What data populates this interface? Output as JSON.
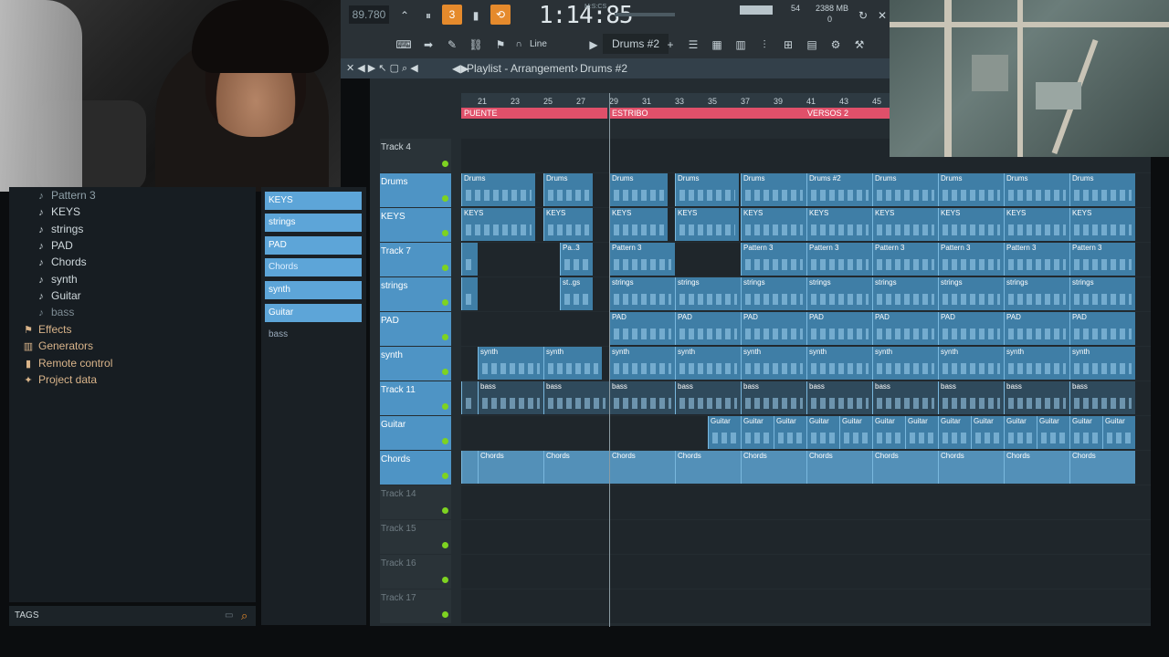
{
  "toolbar": {
    "tempo": "89.780",
    "time": "1:14:85",
    "time_label": "M:S:CS",
    "cpu": "54",
    "memory": "2388 MB",
    "poly": "0",
    "snap": "Line",
    "pattern": "Drums #2"
  },
  "playlist": {
    "breadcrumb": "Playlist - Arrangement",
    "pattern": "Drums #2",
    "ruler": [
      "21",
      "23",
      "25",
      "27",
      "29",
      "31",
      "33",
      "35",
      "37",
      "39",
      "41",
      "43",
      "45"
    ],
    "markers": [
      "PUENTE",
      "ESTRIBO",
      "VERSOS 2"
    ],
    "tracks": [
      {
        "name": "Track 4"
      },
      {
        "name": "Drums"
      },
      {
        "name": "KEYS"
      },
      {
        "name": "Track 7"
      },
      {
        "name": "strings"
      },
      {
        "name": "PAD"
      },
      {
        "name": "synth"
      },
      {
        "name": "Track 11"
      },
      {
        "name": "Guitar"
      },
      {
        "name": "Chords"
      },
      {
        "name": "Track 14"
      },
      {
        "name": "Track 15"
      },
      {
        "name": "Track 16"
      },
      {
        "name": "Track 17"
      }
    ],
    "clips": {
      "drums": "Drums",
      "drums2": "Drums #2",
      "keys": "KEYS",
      "pattern3": "Pattern 3",
      "pa3": "Pa..3",
      "strings": "strings",
      "st_gs": "st..gs",
      "pad": "PAD",
      "synth": "synth",
      "bass": "bass",
      "guitar": "Guitar",
      "chords": "Chords"
    }
  },
  "browser": {
    "items": [
      "Pattern 3",
      "KEYS",
      "strings",
      "PAD",
      "Chords",
      "synth",
      "Guitar",
      "bass",
      "Effects",
      "Generators",
      "Remote control",
      "Project data"
    ],
    "tags": "TAGS"
  },
  "picker": {
    "items": [
      "KEYS",
      "strings",
      "PAD",
      "Chords",
      "synth",
      "Guitar",
      "bass"
    ]
  },
  "colors": {
    "accent": "#5da5d8",
    "marker": "#e0506a",
    "led": "#7ed321",
    "clip": "#3f7ea6"
  }
}
